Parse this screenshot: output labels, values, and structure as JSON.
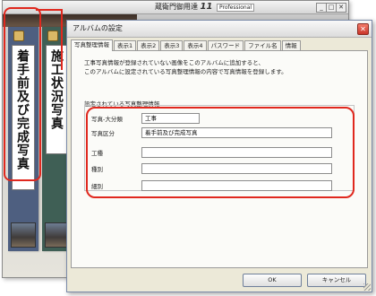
{
  "main_window": {
    "title_prefix": "蔵衛門御用達",
    "title_version": "11",
    "title_edition": "Professional",
    "controls": [
      "_",
      "□",
      "✕"
    ]
  },
  "albums": [
    {
      "label": "着手前及び完成写真",
      "color": "#4e5f80"
    },
    {
      "label": "施工状況写真",
      "color": "#3f5f55"
    }
  ],
  "dialog": {
    "title": "アルバムの設定",
    "close": "✕",
    "tabs": [
      "写真整理情報",
      "表示1",
      "表示2",
      "表示3",
      "表示4",
      "パスワード",
      "ファイル名",
      "情報"
    ],
    "description_line1": "工事写真情報が登録されていない画像をこのアルバムに追加すると、",
    "description_line2": "このアルバムに設定されている写真整理情報の内容で写真情報を登録します。",
    "group_label": "設定されている写真整理情報",
    "fields": {
      "major_category": {
        "label": "写真-大分類",
        "value": "工事"
      },
      "category": {
        "label": "写真区分",
        "value": "着手前及び完成写真"
      },
      "work_type": {
        "label": "工種",
        "value": ""
      },
      "kind": {
        "label": "種別",
        "value": ""
      },
      "detail": {
        "label": "細別",
        "value": ""
      }
    },
    "ok_label": "OK",
    "cancel_label": "キャンセル"
  },
  "colors": {
    "highlight": "#e0281e",
    "dialog_bg": "#ece9d8",
    "panel_bg": "#fbfbf8"
  }
}
